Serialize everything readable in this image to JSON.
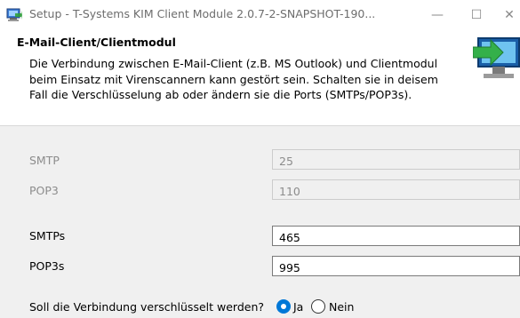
{
  "window": {
    "title": "Setup - T-Systems KIM Client Module 2.0.7-2-SNAPSHOT-190...",
    "minimize_glyph": "—",
    "maximize_glyph": "☐",
    "close_glyph": "✕"
  },
  "header": {
    "title": "E-Mail-Client/Clientmodul",
    "description": "Die Verbindung zwischen E-Mail-Client (z.B. MS Outlook) und Clientmodul beim Einsatz mit Virenscannern kann gestört sein. Schalten sie in deisem Fall die Verschlüsselung ab oder ändern sie die Ports (SMTPs/POP3s).",
    "icon": "computer-install-arrow-icon"
  },
  "form": {
    "smtp": {
      "label": "SMTP",
      "value": "25",
      "enabled": false
    },
    "pop3": {
      "label": "POP3",
      "value": "110",
      "enabled": false
    },
    "smtps": {
      "label": "SMTPs",
      "value": "465",
      "enabled": true
    },
    "pop3s": {
      "label": "POP3s",
      "value": "995",
      "enabled": true
    }
  },
  "encryption": {
    "question": "Soll die Verbindung verschlüsselt werden?",
    "options": [
      "Ja",
      "Nein"
    ],
    "selected": "Ja"
  },
  "colors": {
    "accent": "#0078d7",
    "disabled_text": "#8c8c8c"
  }
}
